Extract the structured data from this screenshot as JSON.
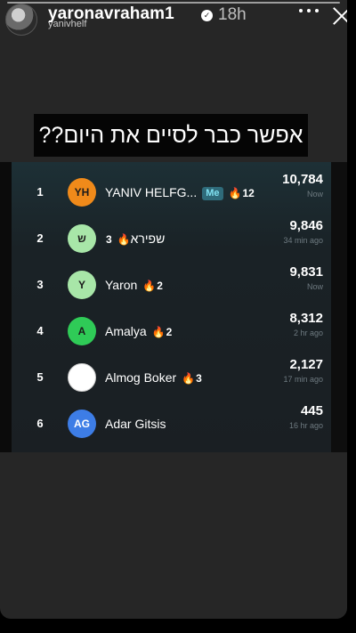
{
  "header": {
    "username": "yaronavraham1",
    "verified_mark": "✓",
    "time": "18h",
    "sub_user": "yanivhelf"
  },
  "caption": "אפשר כבר לסיים את היום??",
  "leaderboard": {
    "rows": [
      {
        "rank": "1",
        "initials": "YH",
        "name": "YANIV HELFG...",
        "me": "Me",
        "streak": "12",
        "score": "10,784",
        "ago": "Now",
        "avatar_color": "#f08a1a",
        "initials_color": "#1b1b1b"
      },
      {
        "rank": "2",
        "initials": "ש",
        "name": "שפירא",
        "me": "",
        "streak": "3",
        "score": "9,846",
        "ago": "34 min ago",
        "avatar_color": "#a8e6a8",
        "initials_color": "#1b1b1b"
      },
      {
        "rank": "3",
        "initials": "Y",
        "name": "Yaron",
        "me": "",
        "streak": "2",
        "score": "9,831",
        "ago": "Now",
        "avatar_color": "#a8e6a8",
        "initials_color": "#1b1b1b"
      },
      {
        "rank": "4",
        "initials": "A",
        "name": "Amalya",
        "me": "",
        "streak": "2",
        "score": "8,312",
        "ago": "2 hr ago",
        "avatar_color": "#2fcb57",
        "initials_color": "#1b1b1b"
      },
      {
        "rank": "5",
        "initials": "",
        "name": "Almog Boker",
        "me": "",
        "streak": "3",
        "score": "2,127",
        "ago": "17 min ago",
        "avatar_color": "#ffffff",
        "initials_color": "#1b1b1b"
      },
      {
        "rank": "6",
        "initials": "AG",
        "name": "Adar Gitsis",
        "me": "",
        "streak": "",
        "score": "445",
        "ago": "16 hr ago",
        "avatar_color": "#3d7de6",
        "initials_color": "#ffffff"
      }
    ]
  },
  "icons": {
    "fire": "🔥"
  }
}
